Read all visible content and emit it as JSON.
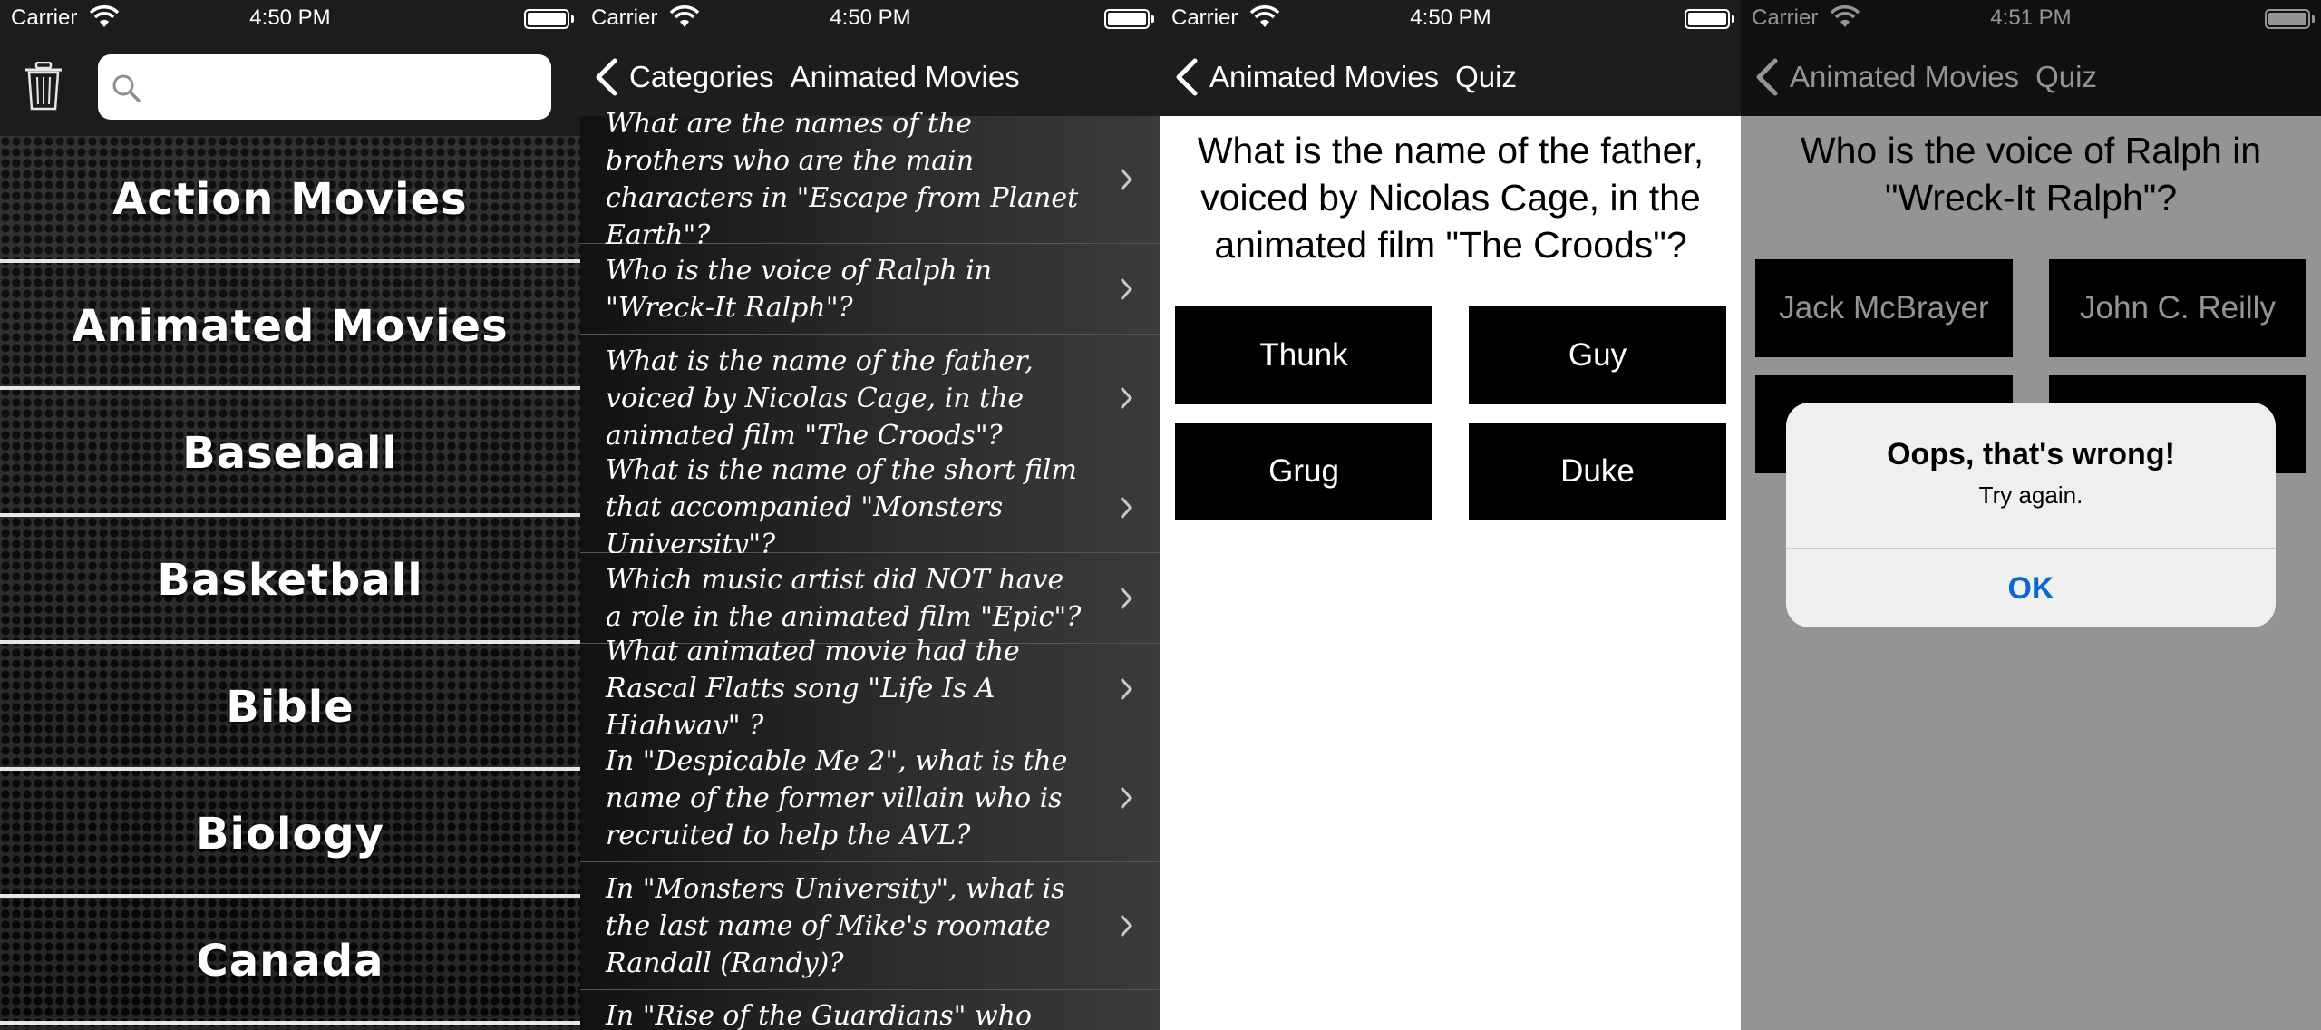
{
  "panels": {
    "categories": {
      "status": {
        "carrier": "Carrier",
        "time": "4:50 PM"
      },
      "search": {
        "placeholder": "",
        "value": ""
      },
      "items": [
        "Action Movies",
        "Animated Movies",
        "Baseball",
        "Basketball",
        "Bible",
        "Biology",
        "Canada"
      ]
    },
    "questions": {
      "status": {
        "carrier": "Carrier",
        "time": "4:50 PM"
      },
      "nav": {
        "back_label": "Categories",
        "title": "Animated Movies"
      },
      "items": [
        "What are the names of the brothers who are the main characters in \"Escape from Planet Earth\"?",
        "Who is the voice of Ralph in \"Wreck-It Ralph\"?",
        "What is the name of the father, voiced by Nicolas Cage, in the animated film \"The Croods\"?",
        "What is the name of the short film that accompanied \"Monsters University\"?",
        "Which music artist did NOT have a role in the animated film \"Epic\"?",
        "What animated movie had the Rascal Flatts song \"Life Is A Highway\" ?",
        "In \"Despicable Me 2\", what is the name of the former villain who is recruited to help the AVL?",
        "In \"Monsters University\", what is the last name of Mike's roomate Randall (Randy)?",
        "In \"Rise of the Guardians\" who created"
      ]
    },
    "quiz": {
      "status": {
        "carrier": "Carrier",
        "time": "4:50 PM"
      },
      "nav": {
        "back_label": "Animated Movies",
        "title": "Quiz"
      },
      "question": "What is the name of the father, voiced by Nicolas Cage, in the animated film \"The Croods\"?",
      "answers": [
        "Thunk",
        "Guy",
        "Grug",
        "Duke"
      ]
    },
    "quiz_alert": {
      "status": {
        "carrier": "Carrier",
        "time": "4:51 PM"
      },
      "nav": {
        "back_label": "Animated Movies",
        "title": "Quiz"
      },
      "question": "Who is the voice of Ralph in \"Wreck-It Ralph\"?",
      "answers": [
        "Jack McBrayer",
        "John C. Reilly",
        "",
        ""
      ],
      "alert": {
        "title": "Oops, that's wrong!",
        "message": "Try again.",
        "button": "OK"
      }
    }
  },
  "colors": {
    "alert_button": "#0a66d6",
    "navbar": "#1d1d1d",
    "category_divider": "#e6e6e6"
  },
  "icons": [
    "wifi-icon",
    "battery-icon",
    "trash-icon",
    "search-icon",
    "back-chevron-icon",
    "disclosure-chevron-icon"
  ]
}
